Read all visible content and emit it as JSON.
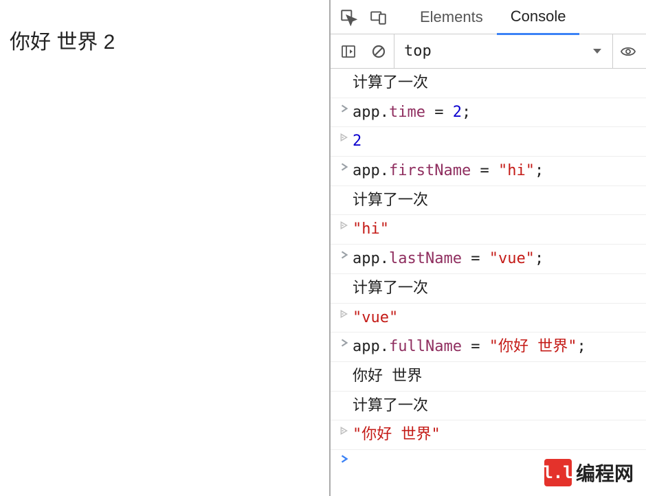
{
  "page": {
    "content": "你好 世界 2"
  },
  "tabs": {
    "elements": "Elements",
    "console": "Console"
  },
  "filter": {
    "context": "top"
  },
  "console": {
    "rows": [
      {
        "kind": "log",
        "text": "计算了一次"
      },
      {
        "kind": "input",
        "segments": [
          {
            "t": "app.",
            "c": "black"
          },
          {
            "t": "time",
            "c": "prop"
          },
          {
            "t": " = ",
            "c": "black"
          },
          {
            "t": "2",
            "c": "num"
          },
          {
            "t": ";",
            "c": "black"
          }
        ]
      },
      {
        "kind": "result",
        "segments": [
          {
            "t": "2",
            "c": "num"
          }
        ]
      },
      {
        "kind": "input",
        "segments": [
          {
            "t": "app.",
            "c": "black"
          },
          {
            "t": "firstName",
            "c": "prop"
          },
          {
            "t": " = ",
            "c": "black"
          },
          {
            "t": "\"hi\"",
            "c": "str"
          },
          {
            "t": ";",
            "c": "black"
          }
        ]
      },
      {
        "kind": "log",
        "text": "计算了一次"
      },
      {
        "kind": "result",
        "segments": [
          {
            "t": "\"hi\"",
            "c": "str"
          }
        ]
      },
      {
        "kind": "input",
        "segments": [
          {
            "t": "app.",
            "c": "black"
          },
          {
            "t": "lastName",
            "c": "prop"
          },
          {
            "t": " = ",
            "c": "black"
          },
          {
            "t": "\"vue\"",
            "c": "str"
          },
          {
            "t": ";",
            "c": "black"
          }
        ]
      },
      {
        "kind": "log",
        "text": "计算了一次"
      },
      {
        "kind": "result",
        "segments": [
          {
            "t": "\"vue\"",
            "c": "str"
          }
        ]
      },
      {
        "kind": "input",
        "segments": [
          {
            "t": "app.",
            "c": "black"
          },
          {
            "t": "fullName",
            "c": "prop"
          },
          {
            "t": " = ",
            "c": "black"
          },
          {
            "t": "\"你好 世界\"",
            "c": "str"
          },
          {
            "t": ";",
            "c": "black"
          }
        ]
      },
      {
        "kind": "log",
        "text": "你好 世界"
      },
      {
        "kind": "log",
        "text": "计算了一次"
      },
      {
        "kind": "result",
        "segments": [
          {
            "t": "\"你好 世界\"",
            "c": "str"
          }
        ]
      }
    ]
  },
  "watermark": {
    "text": "编程网"
  }
}
